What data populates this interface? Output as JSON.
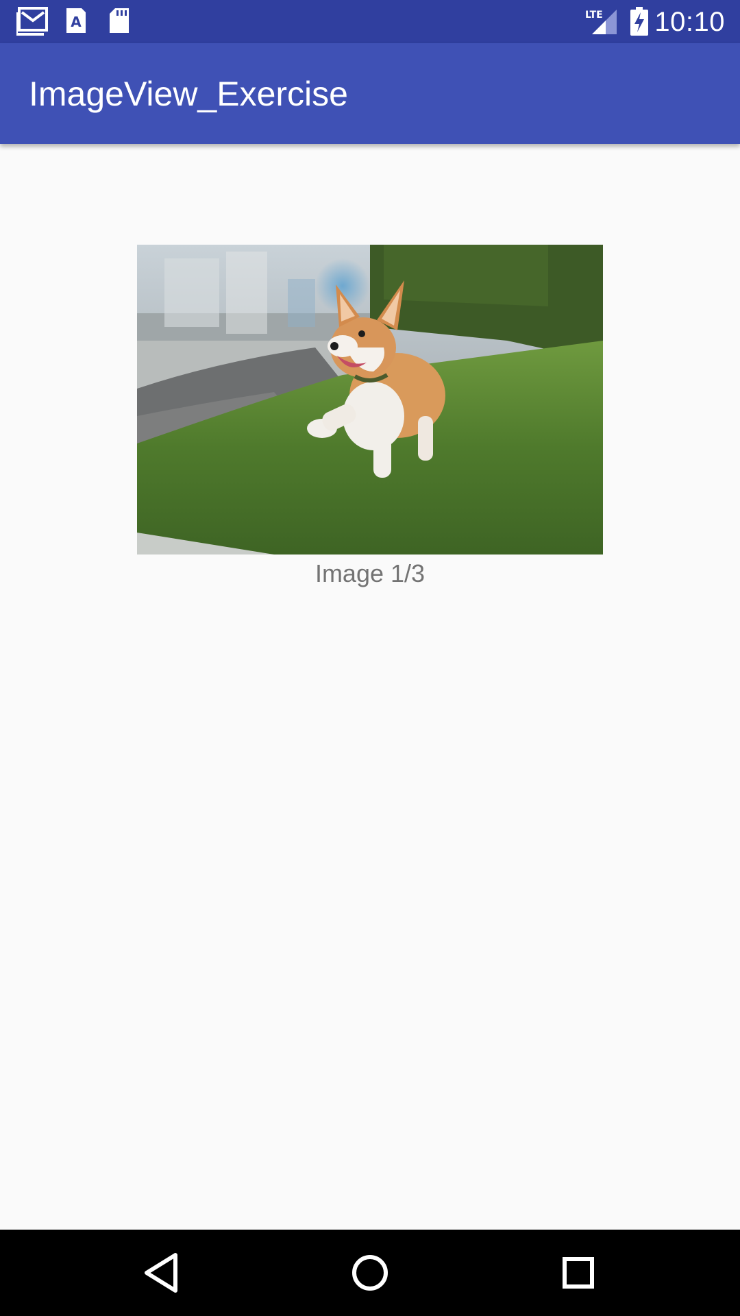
{
  "status_bar": {
    "time": "10:10",
    "network_label": "LTE",
    "icons": [
      "gmail-icon",
      "font-app-icon",
      "sd-card-icon",
      "lte-signal-icon",
      "battery-charging-icon"
    ]
  },
  "app_bar": {
    "title": "ImageView_Exercise"
  },
  "main": {
    "image": {
      "description_icon": "corgi-photo",
      "caption": "Image 1/3"
    }
  },
  "nav_bar": {
    "icons": [
      "back-icon",
      "home-icon",
      "recents-icon"
    ]
  },
  "colors": {
    "status_bar": "#303f9f",
    "app_bar": "#3f51b5",
    "background": "#fafafa",
    "caption_text": "#737373",
    "nav_bar": "#000000"
  }
}
